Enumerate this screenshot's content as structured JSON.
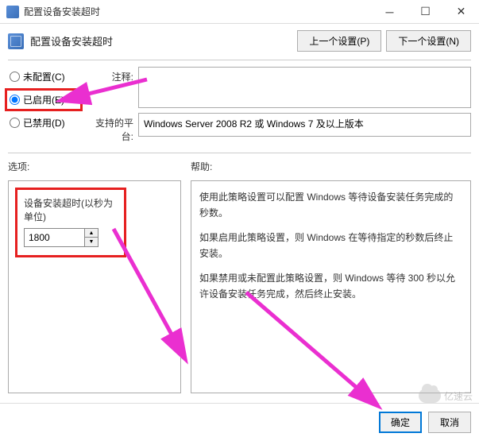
{
  "window": {
    "title": "配置设备安装超时"
  },
  "header": {
    "title": "配置设备安装超时",
    "prev_btn": "上一个设置(P)",
    "next_btn": "下一个设置(N)"
  },
  "radios": {
    "not_configured": "未配置(C)",
    "enabled": "已启用(E)",
    "disabled": "已禁用(D)",
    "selected": "enabled"
  },
  "fields": {
    "comment_label": "注释:",
    "comment_value": "",
    "platform_label": "支持的平台:",
    "platform_value": "Windows Server 2008 R2 或 Windows 7 及以上版本"
  },
  "options": {
    "header": "选项:",
    "timeout_label": "设备安装超时(以秒为单位)",
    "timeout_value": "1800"
  },
  "help": {
    "header": "帮助:",
    "p1": "使用此策略设置可以配置 Windows 等待设备安装任务完成的秒数。",
    "p2": "如果启用此策略设置，则 Windows 在等待指定的秒数后终止安装。",
    "p3": "如果禁用或未配置此策略设置，则 Windows 等待 300 秒以允许设备安装任务完成，然后终止安装。"
  },
  "footer": {
    "ok": "确定",
    "cancel": "取消"
  },
  "watermark": "亿速云"
}
